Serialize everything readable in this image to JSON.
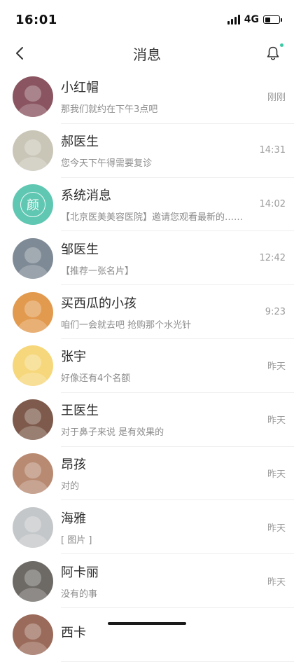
{
  "status_bar": {
    "time": "16:01",
    "network": "4G",
    "battery_level": 0.45
  },
  "header": {
    "title": "消息",
    "back_icon": "chevron-left-icon",
    "bell_icon": "bell-icon",
    "accent_color": "#3cc9a3"
  },
  "messages": [
    {
      "name": "小红帽",
      "preview": "那我们就约在下午3点吧",
      "time": "刚刚",
      "avatar_color": "#8a5560"
    },
    {
      "name": "郝医生",
      "preview": "您今天下午得需要复诊",
      "time": "14:31",
      "avatar_color": "#c9c6b8"
    },
    {
      "name": "系统消息",
      "preview": "【北京医美美容医院】邀请您观看最新的……",
      "time": "14:02",
      "avatar_color": "#5fc7b2",
      "avatar_glyph": "颜"
    },
    {
      "name": "邹医生",
      "preview": "【推荐一张名片】",
      "time": "12:42",
      "avatar_color": "#7e8a95"
    },
    {
      "name": "买西瓜的小孩",
      "preview": "咱们一会就去吧  抢购那个水光针",
      "time": "9:23",
      "avatar_color": "#e29a4f"
    },
    {
      "name": "张宇",
      "preview": "好像还有4个名额",
      "time": "昨天",
      "avatar_color": "#f6d77b"
    },
    {
      "name": "王医生",
      "preview": "对于鼻子来说  是有效果的",
      "time": "昨天",
      "avatar_color": "#7d5a4b"
    },
    {
      "name": "昂孩",
      "preview": "对的",
      "time": "昨天",
      "avatar_color": "#b88a72"
    },
    {
      "name": "海雅",
      "preview": "[ 图片 ]",
      "time": "昨天",
      "avatar_color": "#c4c7c9"
    },
    {
      "name": "阿卡丽",
      "preview": "没有的事",
      "time": "昨天",
      "avatar_color": "#6d6a66"
    },
    {
      "name": "西卡",
      "preview": "",
      "time": "",
      "avatar_color": "#9a6b5a"
    }
  ]
}
